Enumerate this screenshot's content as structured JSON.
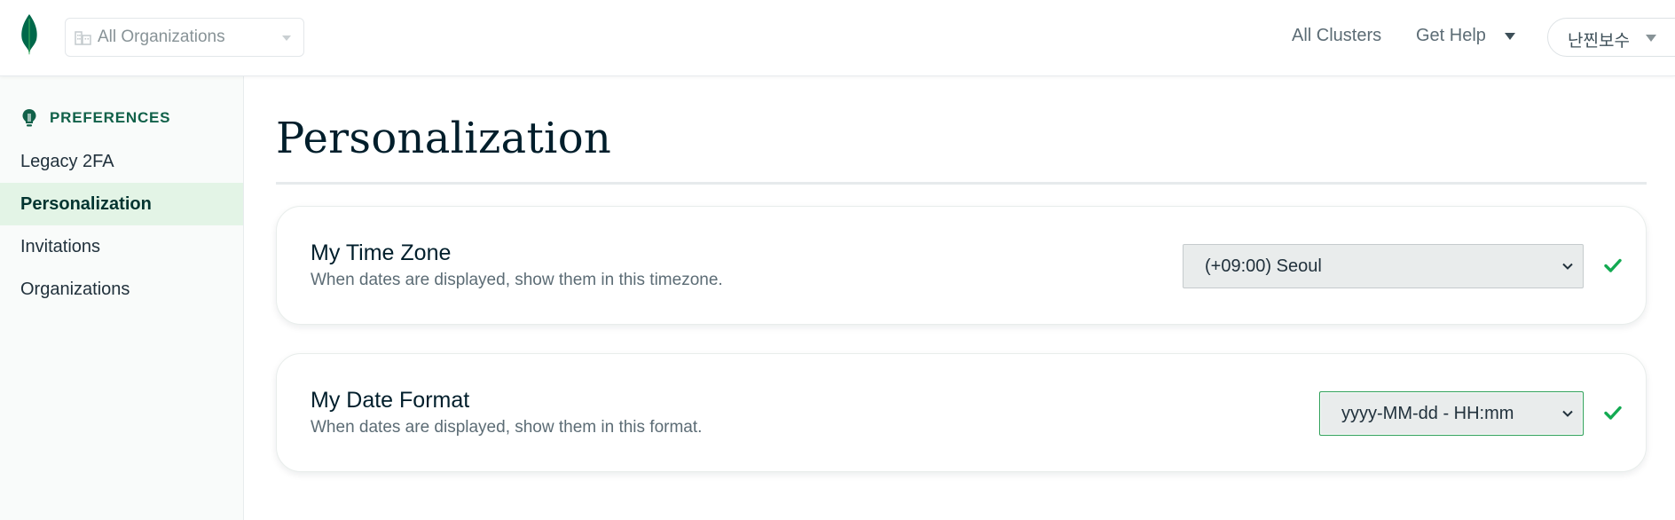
{
  "topbar": {
    "org_selector": {
      "label": "All Organizations",
      "icon": "building-icon"
    },
    "nav": {
      "all_clusters": "All Clusters",
      "get_help": "Get Help"
    },
    "user": {
      "name": "난찐보수"
    }
  },
  "sidebar": {
    "header": "PREFERENCES",
    "items": [
      {
        "label": "Legacy 2FA",
        "active": false
      },
      {
        "label": "Personalization",
        "active": true
      },
      {
        "label": "Invitations",
        "active": false
      },
      {
        "label": "Organizations",
        "active": false
      }
    ]
  },
  "main": {
    "title": "Personalization",
    "timezone": {
      "title": "My Time Zone",
      "description": "When dates are displayed, show them in this timezone.",
      "selected": "(+09:00) Seoul",
      "saved": true
    },
    "date_format": {
      "title": "My Date Format",
      "description": "When dates are displayed, show them in this format.",
      "selected": "yyyy-MM-dd - HH:mm",
      "saved": true
    }
  },
  "colors": {
    "brand_green": "#116149",
    "leaf_green": "#00684a",
    "check_green": "#13aa52",
    "active_bg": "#e3f4e6",
    "focus_border": "#2a9d55"
  }
}
